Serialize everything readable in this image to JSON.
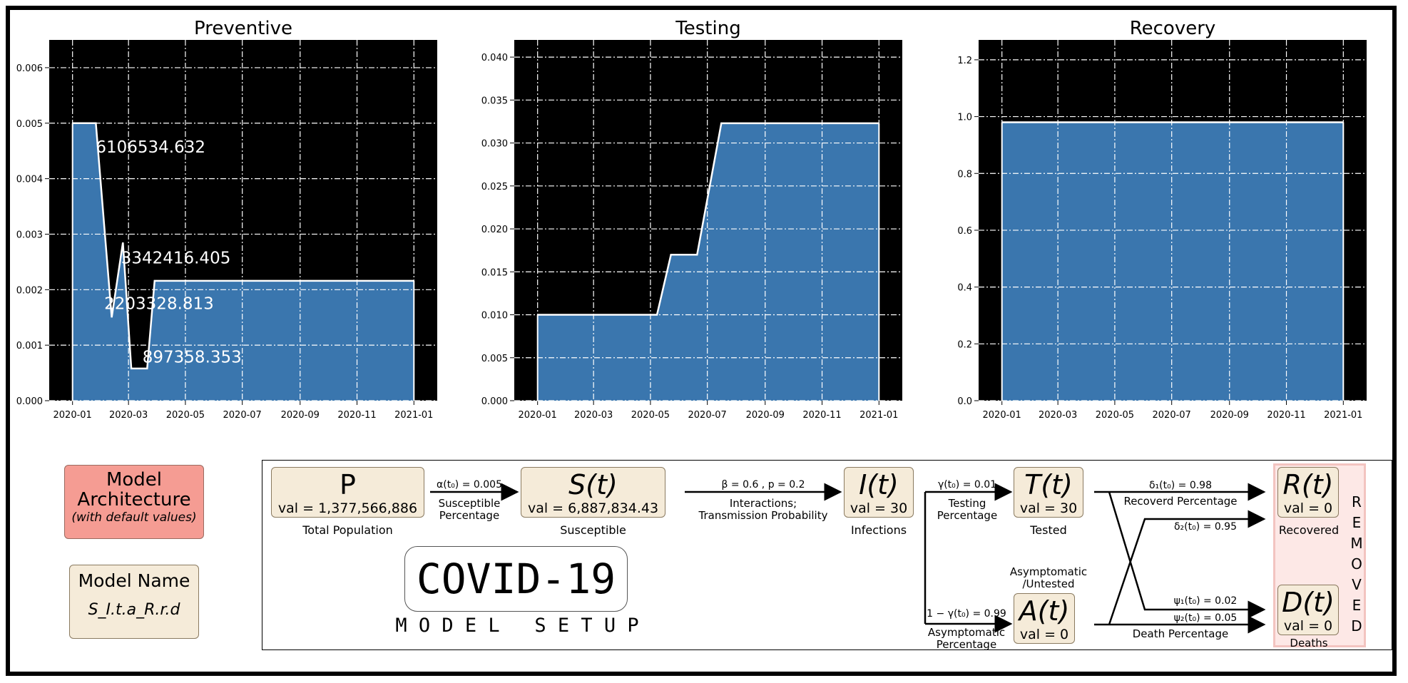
{
  "colors": {
    "fill": "#3a76ae",
    "plot_bg": "#000000",
    "grid": "#ffffff",
    "line": "#ffffff",
    "model_box": "#f59c93",
    "name_box": "#f5ebd9",
    "node": "#f5ebd9",
    "removed": "#fde8e6"
  },
  "chart_data": [
    {
      "type": "area",
      "title": "Preventive",
      "x": [
        "2020-01-01",
        "2020-01-26",
        "2020-02-12",
        "2020-02-24",
        "2020-03-04",
        "2020-03-21",
        "2020-03-29",
        "2021-01-01"
      ],
      "y": [
        0.005,
        0.005,
        0.0015,
        0.00285,
        0.00058,
        0.00058,
        0.00216,
        0.00216
      ],
      "xticks": [
        "2020-01",
        "2020-03",
        "2020-05",
        "2020-07",
        "2020-09",
        "2020-11",
        "2021-01"
      ],
      "yticks": [
        "0.000",
        "0.001",
        "0.002",
        "0.003",
        "0.004",
        "0.005",
        "0.006"
      ],
      "ylim": [
        0,
        0.0065
      ],
      "grid": true,
      "annotations": [
        {
          "text": "6106534.632",
          "x": "2020-01-26",
          "y": 0.00447
        },
        {
          "text": "3342416.405",
          "x": "2020-02-22",
          "y": 0.00247
        },
        {
          "text": "2203328.813",
          "x": "2020-02-04",
          "y": 0.00165
        },
        {
          "text": "897358.353",
          "x": "2020-03-16",
          "y": 0.00069
        }
      ]
    },
    {
      "type": "area",
      "title": "Testing",
      "x": [
        "2020-01-01",
        "2020-05-08",
        "2020-05-23",
        "2020-06-20",
        "2020-07-16",
        "2021-01-01"
      ],
      "y": [
        0.01,
        0.01,
        0.017,
        0.017,
        0.0323,
        0.0323
      ],
      "xticks": [
        "2020-01",
        "2020-03",
        "2020-05",
        "2020-07",
        "2020-09",
        "2020-11",
        "2021-01"
      ],
      "yticks": [
        "0.000",
        "0.005",
        "0.010",
        "0.015",
        "0.020",
        "0.025",
        "0.030",
        "0.035",
        "0.040"
      ],
      "ylim": [
        0,
        0.042
      ],
      "grid": true,
      "annotations": []
    },
    {
      "type": "area",
      "title": "Recovery",
      "x": [
        "2020-01-01",
        "2021-01-01"
      ],
      "y": [
        0.98,
        0.98
      ],
      "xticks": [
        "2020-01",
        "2020-03",
        "2020-05",
        "2020-07",
        "2020-09",
        "2020-11",
        "2021-01"
      ],
      "yticks": [
        "0.0",
        "0.2",
        "0.4",
        "0.6",
        "0.8",
        "1.0",
        "1.2"
      ],
      "ylim": [
        0,
        1.27
      ],
      "grid": true,
      "annotations": []
    }
  ],
  "legend": {
    "model_arch_line1": "Model",
    "model_arch_line2": "Architecture",
    "model_arch_sub": "(with default values)",
    "model_name_label": "Model Name",
    "model_name_value": "S_I.t.a_R.r.d"
  },
  "diagram": {
    "P": {
      "symbol": "P",
      "val": "val = 1,377,566,886",
      "caption": "Total Population"
    },
    "S": {
      "symbol": "S(t)",
      "val": "val = 6,887,834.43",
      "caption": "Susceptible"
    },
    "I": {
      "symbol": "I(t)",
      "val": "val = 30",
      "caption": "Infections"
    },
    "T": {
      "symbol": "T(t)",
      "val": "val = 30",
      "caption": "Tested"
    },
    "A": {
      "symbol": "A(t)",
      "val": "val = 0",
      "caption_l1": "Asymptomatic",
      "caption_l2": "/Untested"
    },
    "R": {
      "symbol": "R(t)",
      "val": "val = 0",
      "caption": "Recovered"
    },
    "D": {
      "symbol": "D(t)",
      "val": "val = 0",
      "caption": "Deaths"
    },
    "e_ps_top": "α(t₀) = 0.005",
    "e_ps_l1": "Susceptible",
    "e_ps_l2": "Percentage",
    "e_si_top": "β = 0.6 ,  p = 0.2",
    "e_si_l1": "Interactions;",
    "e_si_l2": "Transmission Probability",
    "e_it_top": "γ(t₀) = 0.01",
    "e_it_l1": "Testing",
    "e_it_l2": "Percentage",
    "e_ia_top": "1 − γ(t₀) = 0.99",
    "e_ia_l1": "Asymptomatic",
    "e_ia_l2": "Percentage",
    "d1": "δ₁(t₀) = 0.98",
    "d1_label": "Recoverd Percentage",
    "d2": "δ₂(t₀) = 0.95",
    "psi1": "ψ₁(t₀) = 0.02",
    "psi2": "ψ₂(t₀) = 0.05",
    "death_label": "Death Percentage",
    "removed": [
      "R",
      "E",
      "M",
      "O",
      "V",
      "E",
      "D"
    ],
    "covid_title": "COVID-19",
    "model_setup": "M O D E L   S E T U P"
  }
}
